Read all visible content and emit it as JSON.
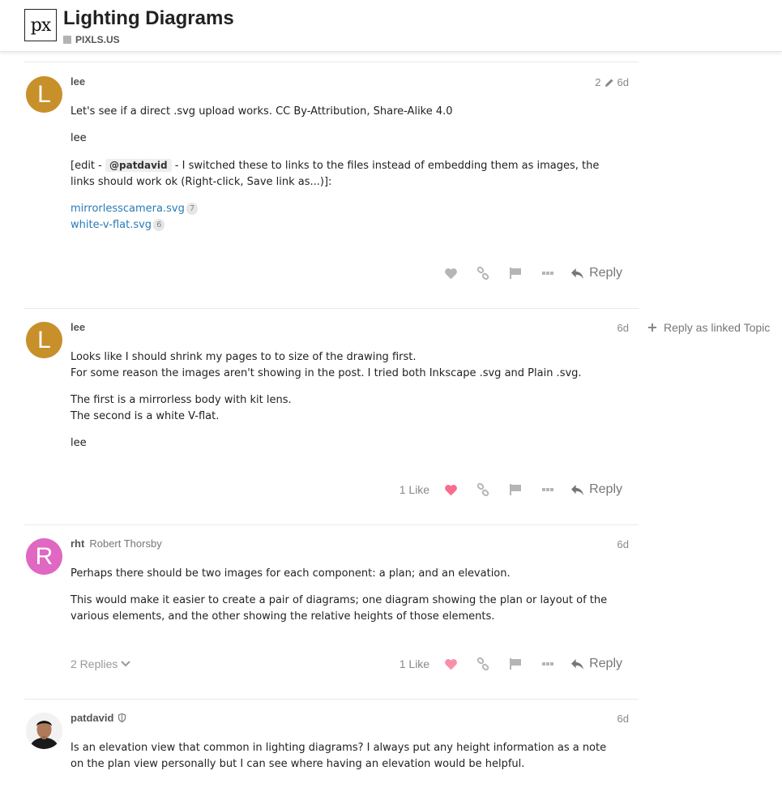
{
  "header": {
    "logo_text": "px",
    "title": "Lighting Diagrams",
    "category": "PIXLS.US",
    "category_color": "#b3b3b3"
  },
  "side": {
    "reply_linked_topic": "Reply as linked Topic"
  },
  "posts": [
    {
      "username": "lee",
      "avatar_letter": "L",
      "avatar_color": "#c8902a",
      "edits": "2",
      "date": "6d",
      "paragraphs": [
        "Let's see if a direct .svg upload works. CC By-Attribution, Share-Alike 4.0",
        "lee"
      ],
      "edit_prefix": "[edit - ",
      "mention": "@patdavid",
      "edit_suffix": " - I switched these to links to the files instead of embedding them as images, the links should work ok (Right-click, Save link as...)]:",
      "links": [
        {
          "text": "mirrorlesscamera.svg",
          "clicks": "7"
        },
        {
          "text": "white-v-flat.svg",
          "clicks": "6"
        }
      ],
      "reply_label": "Reply"
    },
    {
      "username": "lee",
      "avatar_letter": "L",
      "avatar_color": "#c8902a",
      "date": "6d",
      "p1_line1": "Looks like I should shrink my pages to to size of the drawing first.",
      "p1_line2": "For some reason the images aren't showing in the post. I tried both Inkscape .svg and Plain .svg.",
      "p2_line1": "The first is a mirrorless body with kit lens.",
      "p2_line2": "The second is a white V-flat.",
      "p3": "lee",
      "likes": "1 Like",
      "like_color": "#fa6c8d",
      "reply_label": "Reply"
    },
    {
      "username": "rht",
      "fullname": "Robert Thorsby",
      "avatar_letter": "R",
      "avatar_color": "#e067c2",
      "date": "6d",
      "paragraphs": [
        "Perhaps there should be two images for each component: a plan; and an elevation.",
        "This would make it easier to create a pair of diagrams; one diagram showing the plan or layout of the various elements, and the other showing the relative heights of those elements."
      ],
      "replies": "2 Replies",
      "likes": "1 Like",
      "like_color": "#fa6c8d",
      "reply_label": "Reply"
    },
    {
      "username": "patdavid",
      "date": "6d",
      "paragraphs": [
        "Is an elevation view that common in lighting diagrams? I always put any height information as a note on the plan view personally but I can see where having an elevation would be helpful."
      ]
    }
  ]
}
